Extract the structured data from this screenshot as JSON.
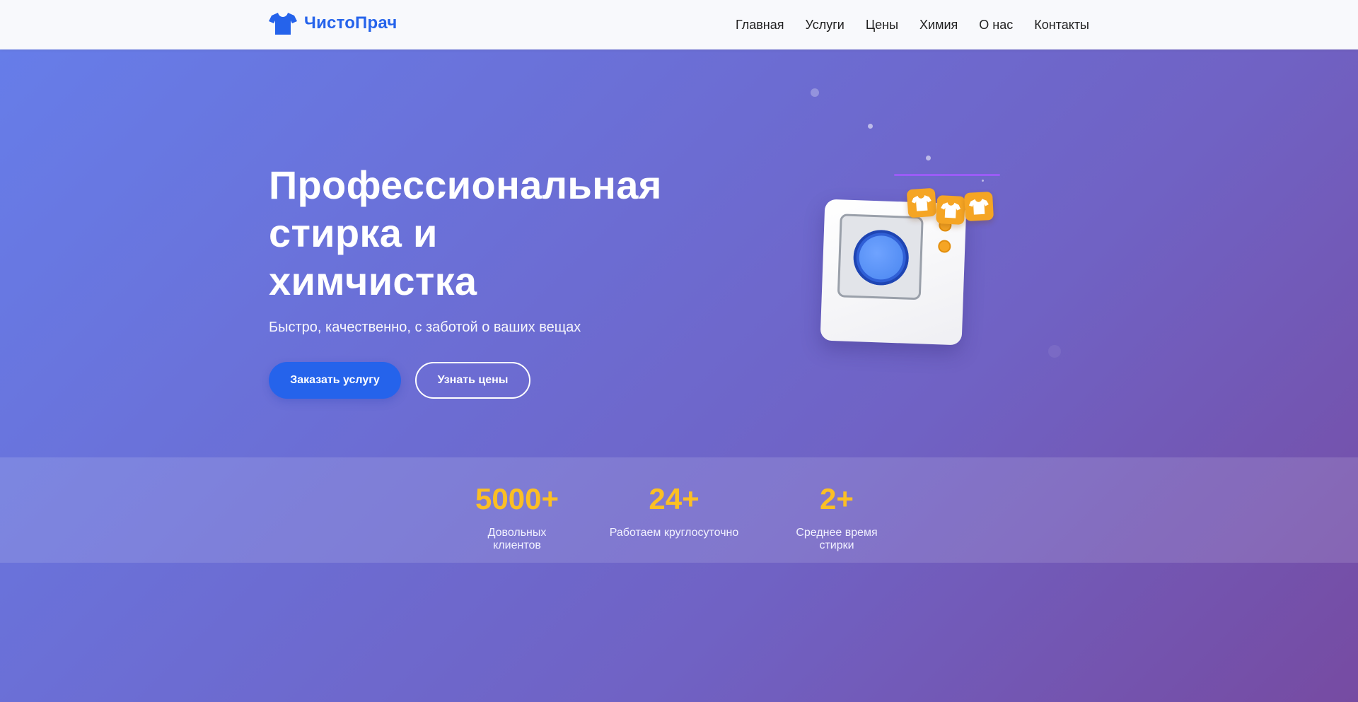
{
  "header": {
    "logo_text": "ЧистоПрач",
    "logo_icon": "tshirt-icon",
    "nav": [
      {
        "label": "Главная"
      },
      {
        "label": "Услуги"
      },
      {
        "label": "Цены"
      },
      {
        "label": "Химия"
      },
      {
        "label": "О нас"
      },
      {
        "label": "Контакты"
      }
    ]
  },
  "hero": {
    "title_line1": "Профессиональная",
    "title_line2": "стирка и",
    "title_line3": "химчистка",
    "subtitle": "Быстро, качественно, с заботой о ваших вещах",
    "primary_button": "Заказать услугу",
    "secondary_button": "Узнать цены",
    "illustration_icon": "washing-machine-icon"
  },
  "stats": [
    {
      "value": "5000+",
      "label": "Довольных клиентов"
    },
    {
      "value": "24+",
      "label": "Работаем круглосуточно"
    },
    {
      "value": "2+",
      "label": "Среднее время стирки"
    }
  ],
  "colors": {
    "brand": "#2563eb",
    "accent": "#fbbf24",
    "gradient_start": "#667eea",
    "gradient_end": "#764ba2"
  }
}
